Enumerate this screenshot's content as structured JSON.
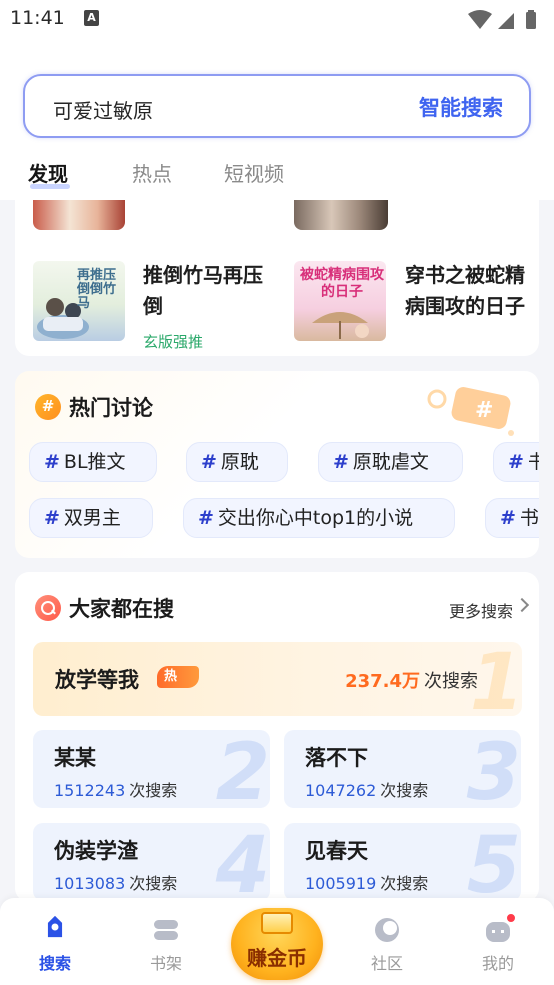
{
  "status_bar": {
    "time": "11:41",
    "notification_icon": "A"
  },
  "search": {
    "query": "可爱过敏原",
    "button_label": "智能搜索"
  },
  "tabs": [
    {
      "label": "发现",
      "active": true
    },
    {
      "label": "热点",
      "active": false
    },
    {
      "label": "短视频",
      "active": false
    }
  ],
  "books": [
    {
      "title": "推倒竹马再压倒",
      "cover_text": "再推压倒倒竹马",
      "tag": "玄版强推"
    },
    {
      "title": "穿书之被蛇精病围攻的日子",
      "cover_text": "被蛇精病围攻的日子"
    }
  ],
  "hot_discussion": {
    "title": "热门讨论",
    "topics_row1": [
      "BL推文",
      "原耽",
      "原耽虐文",
      "书"
    ],
    "topics_row2": [
      "双男主",
      "交出你心中top1的小说",
      "书"
    ]
  },
  "everyone_search": {
    "title": "大家都在搜",
    "more_label": "更多搜索",
    "count_suffix": "次搜索",
    "hot_badge": "热",
    "top_item": {
      "rank": "1",
      "name": "放学等我",
      "count": "237.4万"
    },
    "items": [
      {
        "rank": "2",
        "name": "某某",
        "count": "1512243"
      },
      {
        "rank": "3",
        "name": "落不下",
        "count": "1047262"
      },
      {
        "rank": "4",
        "name": "伪装学渣",
        "count": "1013083"
      },
      {
        "rank": "5",
        "name": "见春天",
        "count": "1005919"
      }
    ]
  },
  "bottom_nav": {
    "search": "搜索",
    "bookshelf": "书架",
    "earn_coins": "赚金币",
    "community": "社区",
    "mine": "我的"
  },
  "colors": {
    "accent": "#2b52e6",
    "hot": "#ff6a1f",
    "badge": "#ff3b4a"
  }
}
